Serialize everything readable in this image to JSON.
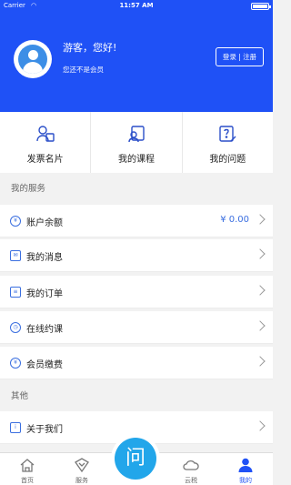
{
  "status": {
    "carrier": "Carrier",
    "time": "11:57 AM"
  },
  "header": {
    "greeting": "游客，您好!",
    "member_status": "您还不是会员",
    "login_label": "登录 | 注册"
  },
  "quick_actions": [
    {
      "label": "发票名片",
      "icon": "invoice-card-icon"
    },
    {
      "label": "我的课程",
      "icon": "course-icon"
    },
    {
      "label": "我的问题",
      "icon": "question-icon"
    }
  ],
  "sections": {
    "services_title": "我的服务",
    "other_title": "其他"
  },
  "services": [
    {
      "label": "账户余额",
      "value": "¥ 0.00",
      "icon": "yen-icon"
    },
    {
      "label": "我的消息",
      "icon": "mail-icon"
    },
    {
      "label": "我的订单",
      "icon": "order-icon"
    },
    {
      "label": "在线约课",
      "icon": "clock-icon"
    },
    {
      "label": "会员缴费",
      "icon": "payment-icon"
    }
  ],
  "other": [
    {
      "label": "关于我们",
      "icon": "info-icon"
    }
  ],
  "tabs": [
    {
      "label": "首页",
      "icon": "home-icon"
    },
    {
      "label": "服务",
      "icon": "service-icon"
    },
    {
      "label": "云税",
      "icon": "cloud-icon"
    },
    {
      "label": "我的",
      "icon": "profile-icon",
      "active": true
    }
  ],
  "ask_button": {
    "label": "问"
  },
  "colors": {
    "primary": "#1f51f6",
    "accent": "#3b6fe0",
    "ask": "#22a6ea"
  }
}
